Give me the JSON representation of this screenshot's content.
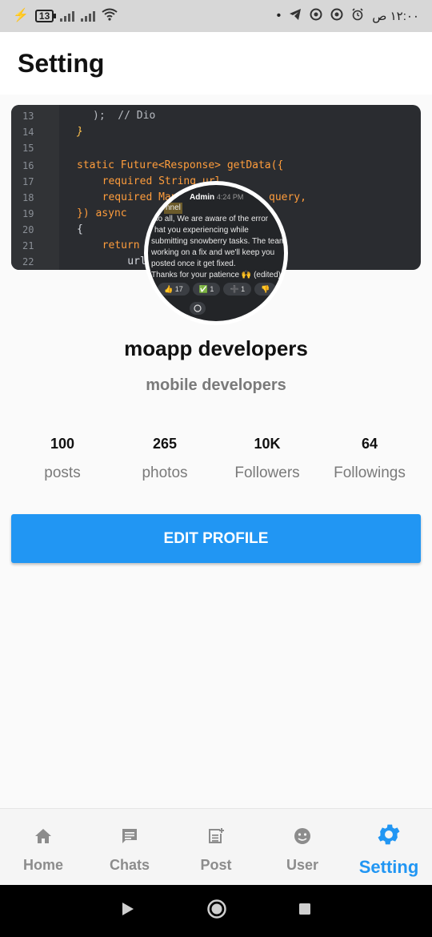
{
  "status_bar": {
    "battery": "13",
    "time": "١٢:٠٠ ص"
  },
  "app_bar": {
    "title": "Setting"
  },
  "cover": {
    "lines": [
      {
        "num": "13",
        "text": ");  // Dio"
      },
      {
        "num": "14",
        "text": "}"
      },
      {
        "num": "15",
        "text": ""
      },
      {
        "num": "16",
        "text": "static Future<Response> getData({"
      },
      {
        "num": "17",
        "text": "  required String url,"
      },
      {
        "num": "18",
        "text": "  required Map<"
      },
      {
        "num": "19",
        "text": "}) async"
      },
      {
        "num": "20",
        "text": "{"
      },
      {
        "num": "21",
        "text": "  return aw"
      },
      {
        "num": "22",
        "text": "    url,"
      }
    ],
    "trailing_text": "query,"
  },
  "avatar": {
    "sender": "Admin",
    "time": "4:24 PM",
    "channel_tag": "nnel",
    "message_lines": [
      "llo all, We are aware of the error",
      "hat you experiencing  while",
      "submitting snowberry tasks. The team",
      "working on a fix and we'll keep you",
      "posted once it get fixed.",
      "Thanks for your patience 🙌 (edited)"
    ],
    "reactions": [
      "👍 17",
      "✅ 1",
      "➕ 1",
      "👎"
    ]
  },
  "profile": {
    "name": "moapp developers",
    "bio": "mobile developers"
  },
  "stats": [
    {
      "value": "100",
      "label": "posts"
    },
    {
      "value": "265",
      "label": "photos"
    },
    {
      "value": "10K",
      "label": "Followers"
    },
    {
      "value": "64",
      "label": "Followings"
    }
  ],
  "edit_button": {
    "label": "EDIT PROFILE"
  },
  "bottom_nav": {
    "items": [
      {
        "label": "Home",
        "icon": "home-icon"
      },
      {
        "label": "Chats",
        "icon": "chat-icon"
      },
      {
        "label": "Post",
        "icon": "post-add-icon"
      },
      {
        "label": "User",
        "icon": "user-icon"
      },
      {
        "label": "Setting",
        "icon": "gear-icon",
        "active": true
      }
    ]
  },
  "colors": {
    "accent": "#2196f3",
    "inactive": "#8c8c8c"
  }
}
